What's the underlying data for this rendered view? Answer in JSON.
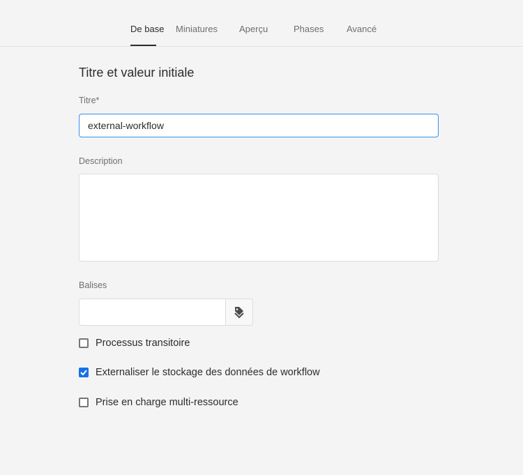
{
  "tabs": [
    {
      "label": "De base",
      "active": true
    },
    {
      "label": "Miniatures"
    },
    {
      "label": "Aperçu"
    },
    {
      "label": "Phases"
    },
    {
      "label": "Avancé"
    }
  ],
  "section_title": "Titre et valeur initiale",
  "title_field": {
    "label": "Titre*",
    "value": "external-workflow"
  },
  "description_field": {
    "label": "Description",
    "value": ""
  },
  "tags_field": {
    "label": "Balises",
    "value": "",
    "icon": "tag-icon"
  },
  "checkboxes": [
    {
      "label": "Processus transitoire",
      "checked": false
    },
    {
      "label": "Externaliser le stockage des données de workflow",
      "checked": true
    },
    {
      "label": "Prise en charge multi-ressource",
      "checked": false
    }
  ],
  "colors": {
    "accent": "#1473e6",
    "focus": "#378ef0"
  }
}
